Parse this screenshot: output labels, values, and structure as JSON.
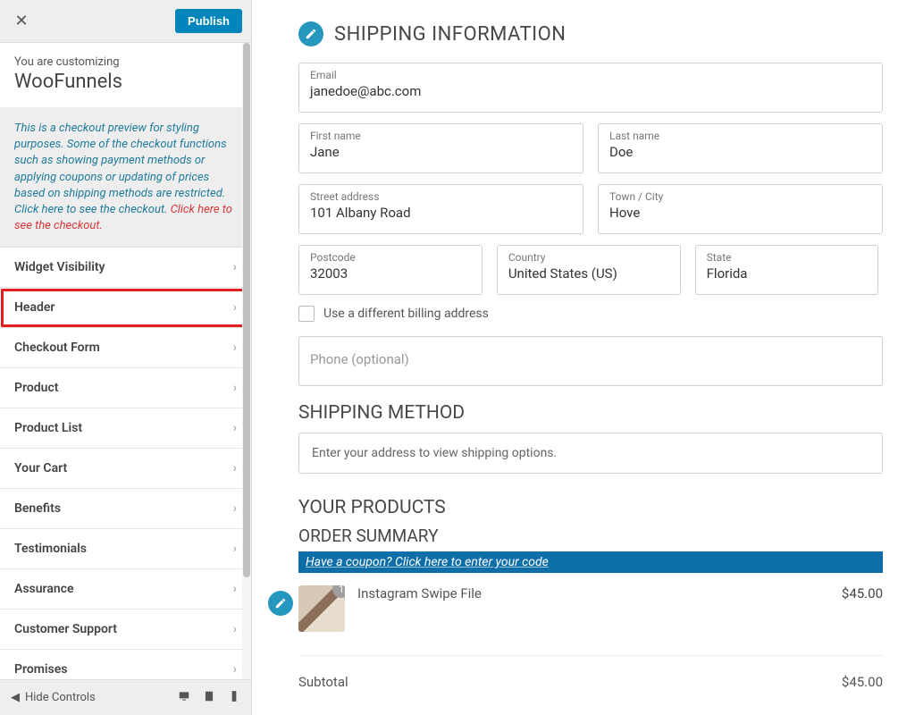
{
  "sidebar": {
    "publish_label": "Publish",
    "context_small": "You are customizing",
    "context_title": "WooFunnels",
    "notice_main": "This is a checkout preview for styling purposes. Some of the checkout functions such as showing payment methods or applying coupons or updating of prices based on shipping methods are restricted. Click here to see the checkout. ",
    "notice_link": "Click here to see the checkout.",
    "menu": [
      {
        "label": "Widget Visibility",
        "hl": false
      },
      {
        "label": "Header",
        "hl": true
      },
      {
        "label": "Checkout Form",
        "hl": false
      },
      {
        "label": "Product",
        "hl": false
      },
      {
        "label": "Product List",
        "hl": false
      },
      {
        "label": "Your Cart",
        "hl": false
      },
      {
        "label": "Benefits",
        "hl": false
      },
      {
        "label": "Testimonials",
        "hl": false
      },
      {
        "label": "Assurance",
        "hl": false
      },
      {
        "label": "Customer Support",
        "hl": false
      },
      {
        "label": "Promises",
        "hl": false
      }
    ],
    "hide_controls": "Hide Controls"
  },
  "shipping_info": {
    "title": "SHIPPING INFORMATION",
    "email": {
      "label": "Email",
      "value": "janedoe@abc.com"
    },
    "first_name": {
      "label": "First name",
      "value": "Jane"
    },
    "last_name": {
      "label": "Last name",
      "value": "Doe"
    },
    "street": {
      "label": "Street address",
      "value": "101 Albany Road"
    },
    "city": {
      "label": "Town / City",
      "value": "Hove"
    },
    "postcode": {
      "label": "Postcode",
      "value": "32003"
    },
    "country": {
      "label": "Country",
      "value": "United States (US)"
    },
    "state": {
      "label": "State",
      "value": "Florida"
    },
    "diff_billing": "Use a different billing address",
    "phone_placeholder": "Phone (optional)"
  },
  "shipping_method": {
    "title": "SHIPPING METHOD",
    "msg": "Enter your address to view shipping options."
  },
  "products": {
    "title": "YOUR PRODUCTS",
    "order_summary": "ORDER SUMMARY",
    "coupon_text": "Have a coupon? Click here to enter your code",
    "items": [
      {
        "name": "Instagram Swipe File",
        "qty": "1",
        "price": "$45.00"
      }
    ],
    "subtotal_label": "Subtotal",
    "subtotal_value": "$45.00"
  }
}
